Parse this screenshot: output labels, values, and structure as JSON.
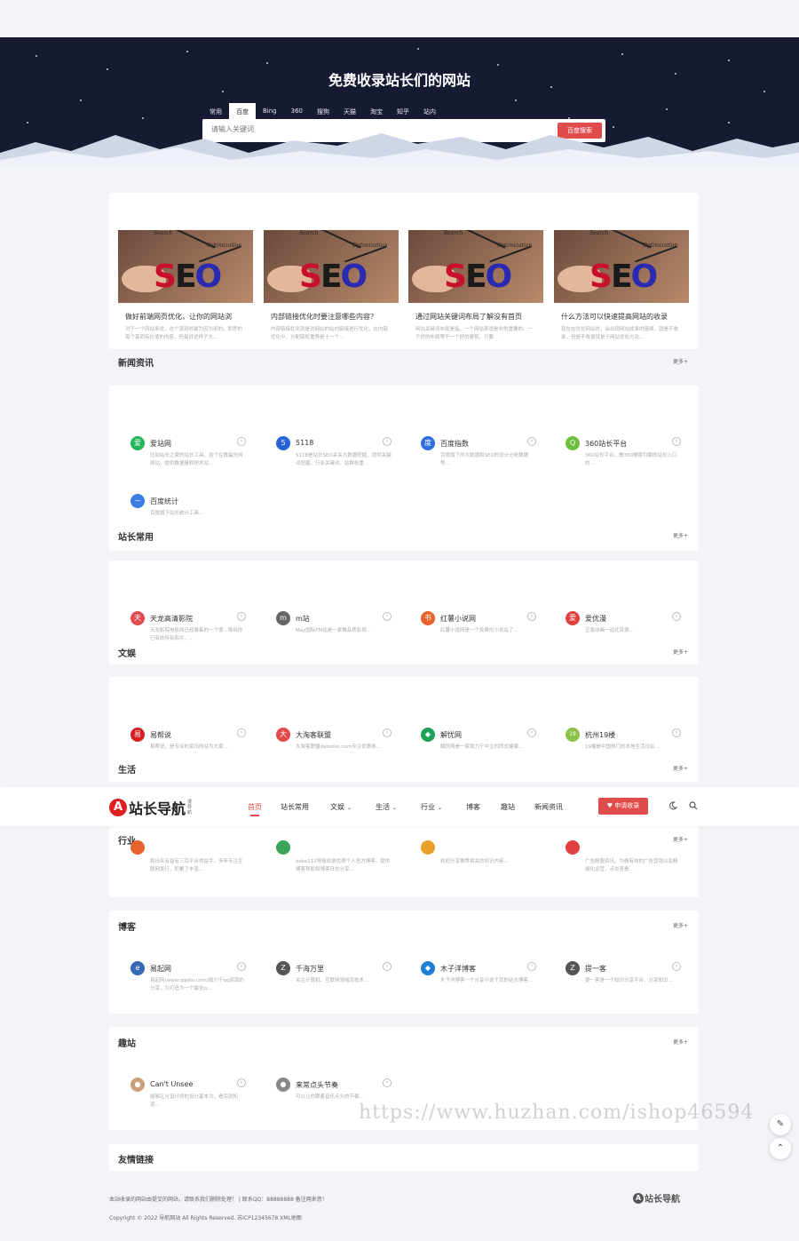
{
  "hero": {
    "title": "免费收录站长们的网站",
    "search_tabs": [
      "常用",
      "百度",
      "Bing",
      "360",
      "搜狗",
      "天猫",
      "淘宝",
      "知乎",
      "站内"
    ],
    "active_tab": "百度",
    "search_placeholder": "请输入关键词",
    "search_button": "百度搜索"
  },
  "more_label": "更多+",
  "news": {
    "title": "新闻资讯",
    "thumb_words": {
      "seo": "SEO",
      "search": "Search",
      "optimization": "Optimization"
    },
    "items": [
      {
        "title": "做好前端网页优化，让你的网站浏",
        "desc": "对于一个网站来说，这个源到时最为因为用的。即思的每个基而有价值的内容，但最好这样子大..."
      },
      {
        "title": "内部链接优化时要注意哪些内容？",
        "desc": "内部链接优化就是对网站的站内链接进行优化，在内链优化中，分配链权重等是十一个..."
      },
      {
        "title": "通过网站关键词布局了解没有首页",
        "desc": "网站关键词布局是指，一个网站来说是非常重要的。一个好的布局等于一个好的建筑。只要..."
      },
      {
        "title": "什么方法可以快速提高网站的收录",
        "desc": "现在在优化网站时，会出现网站收录的困境，就是不收录，但是不收录就是干网站优化方法..."
      }
    ]
  },
  "tools": {
    "title": "站长常用",
    "items": [
      {
        "icon": "ai-zhan-icon",
        "color": "#21b45a",
        "glyph": "爱",
        "name": "爱站网",
        "desc": "比如站长之家的站长工具，这个在算最先网络站，提供数据量和技术站..."
      },
      {
        "icon": "5118-icon",
        "color": "#2563d6",
        "glyph": "5",
        "name": "5118",
        "desc": "5118是站长SEO关关大数据挖掘，提供关键词挖掘，行业关键词，站群权重..."
      },
      {
        "icon": "baidu-icon",
        "color": "#2f6ee0",
        "glyph": "度",
        "name": "百度指数",
        "desc": "百度旗下的大数据和SEO的设计分析数据等..."
      },
      {
        "icon": "360-icon",
        "color": "#6cbf3c",
        "glyph": "Q",
        "name": "360站长平台",
        "desc": "360站长平台，做360搜索引擎的站长入口的..."
      },
      {
        "icon": "baidu-tongji-icon",
        "color": "#3b7fe6",
        "glyph": "~",
        "name": "百度统计",
        "desc": "百度旗下站长统计工具..."
      }
    ]
  },
  "entertainment": {
    "title": "文娱",
    "items": [
      {
        "icon": "tianlong-icon",
        "color": "#e04b4b",
        "glyph": "天",
        "name": "天龙高清影院",
        "desc": "天龙影院电影网已经聚集的一个很...导出你已有的所有影片，..."
      },
      {
        "icon": "m-site-icon",
        "color": "#666666",
        "glyph": "m",
        "name": "m站",
        "desc": "May国际FM站是一家做品质影视..."
      },
      {
        "icon": "hongshu-icon",
        "color": "#e8632b",
        "glyph": "书",
        "name": "红薯小说网",
        "desc": "红薯小说网是一个免费的小说站了..."
      },
      {
        "icon": "aiyouwen-icon",
        "color": "#e04040",
        "glyph": "爱",
        "name": "爱优漫",
        "desc": "正版动画一站式资源..."
      }
    ]
  },
  "life": {
    "title": "生活",
    "items": [
      {
        "icon": "yiyou-icon",
        "color": "#d82020",
        "glyph": "易",
        "name": "易帮说",
        "desc": "易帮说，是专业的资讯网站为大家..."
      },
      {
        "icon": "datao-icon",
        "color": "#e04b4b",
        "glyph": "大",
        "name": "大淘客联盟",
        "desc": "大淘客联盟dataoke.com专注优惠券..."
      },
      {
        "icon": "jieyou-icon",
        "color": "#21a05a",
        "glyph": "◆",
        "name": "解忧网",
        "desc": "解忧网是一家致力于中立的西式健康..."
      },
      {
        "icon": "hangzhou19-icon",
        "color": "#8bc34a",
        "glyph": "19",
        "name": "杭州19楼",
        "desc": "19楼是中国热门的本地生活论坛..."
      }
    ]
  },
  "industry": {
    "title": "行业",
    "items": [
      {
        "icon": "industry-1-icon",
        "color": "#e8632b",
        "glyph": "",
        "name": "",
        "desc": "和出众有益有三百平台得益手、多年专注互联网发行，积累了丰富..."
      },
      {
        "icon": "industry-2-icon",
        "color": "#3aa55a",
        "glyph": "",
        "name": "",
        "desc": "boke112导航收录优质个人官方博客，提供博客导航和博客日志分享..."
      },
      {
        "icon": "industry-3-icon",
        "color": "#e8a02b",
        "glyph": "",
        "name": "",
        "desc": "欢迎分享推荐相关的知识内容..."
      },
      {
        "icon": "industry-4-icon",
        "color": "#e04040",
        "glyph": "",
        "name": "",
        "desc": "广告联盟资讯，为做有效的广告营销以及精细化运营，点击查看..."
      }
    ]
  },
  "blog": {
    "title": "博客",
    "items": [
      {
        "icon": "yiqiwang-icon",
        "color": "#3569b5",
        "glyph": "e",
        "name": "易起网",
        "desc": "易起网(www.qqeku.com)致力于qq资源的分享，为打造为一个最全q..."
      },
      {
        "icon": "qianhaiwanli-icon",
        "color": "#555555",
        "glyph": "Z",
        "name": "千海万里",
        "desc": "关注计算机、互联网领域及技术..."
      },
      {
        "icon": "muziyang-icon",
        "color": "#1f7fd6",
        "glyph": "◆",
        "name": "木子洋博客",
        "desc": "木子洋博客一个分享小说干货的站长博客..."
      },
      {
        "icon": "tiyike-icon",
        "color": "#555555",
        "glyph": "Z",
        "name": "提一客",
        "desc": "提一客是一个知识分享平台，分享知识..."
      }
    ]
  },
  "fun": {
    "title": "趣站",
    "items": [
      {
        "icon": "cant-unsee-icon",
        "color": "#caa07a",
        "glyph": "●",
        "name": "Can't Unsee",
        "desc": "能够区分设计师的设计基本功，看完就知道..."
      },
      {
        "icon": "lanman-icon",
        "color": "#888888",
        "glyph": "●",
        "name": "来常点头节奏",
        "desc": "可以让你跟着音乐点头的节奏..."
      }
    ]
  },
  "friends": {
    "title": "友情链接"
  },
  "navbar": {
    "logo_mark": "A",
    "logo_text": "站长导航",
    "logo_sub": "漫导航",
    "items": [
      "首页",
      "站长常用",
      "文娱",
      "生活",
      "行业",
      "博客",
      "趣站",
      "新闻资讯"
    ],
    "dropdown_items": [
      "文娱",
      "生活",
      "行业"
    ],
    "active": "首页",
    "apply_button": "♥ 申请收录"
  },
  "footer": {
    "line1": "本站收录的网站由提交的网站，请联系我们删除处理！ | 联系QQ：88888888 备注网来意！",
    "line2": "Copyright © 2022 导航网站 All Rights Reserved. 苏ICP12345678 XML地图",
    "logo_mark": "A",
    "logo_text": "站长导航"
  },
  "watermark": "https://www.huzhan.com/ishop46594",
  "colors": {
    "accent": "#e04b4b",
    "hero_bg": "#161a33",
    "page_bg": "#f2f4f8"
  }
}
